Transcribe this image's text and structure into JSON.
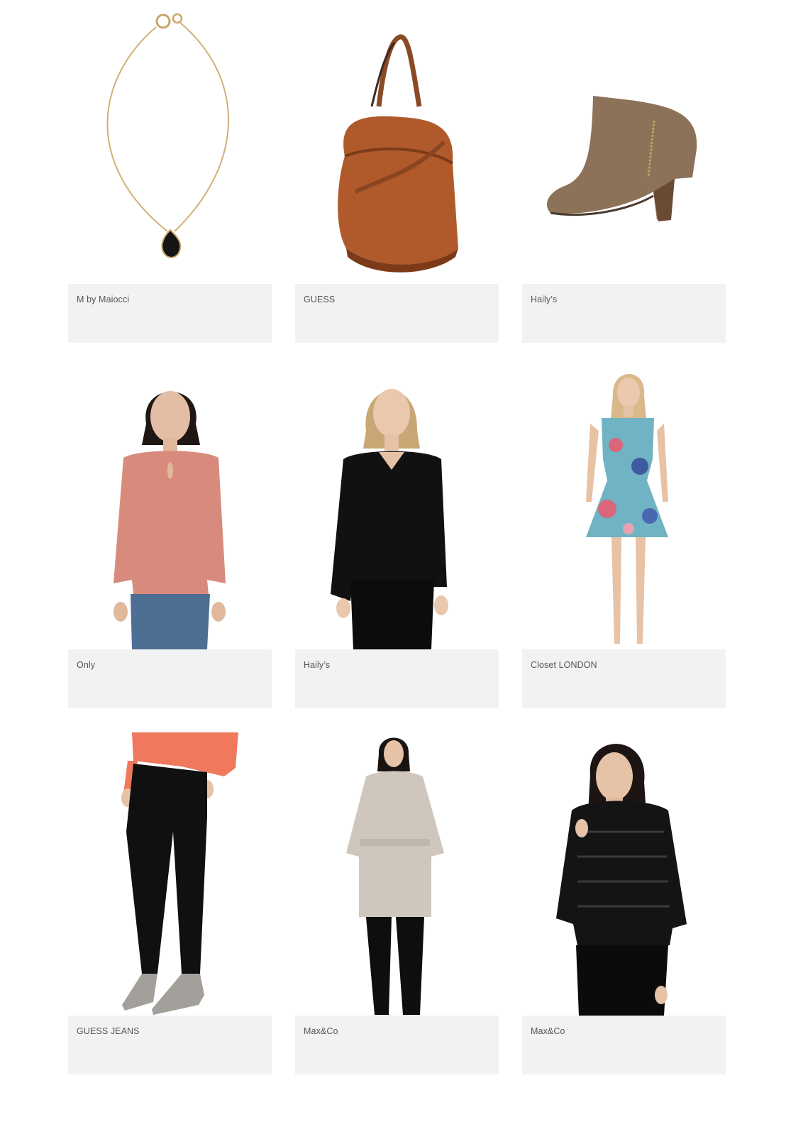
{
  "products": [
    {
      "brand": "M by Maiocci",
      "image": "necklace-image"
    },
    {
      "brand": "GUESS",
      "image": "bucket-bag-image"
    },
    {
      "brand": "Haily’s",
      "image": "ankle-boot-image"
    },
    {
      "brand": "Only",
      "image": "pink-blouse-image"
    },
    {
      "brand": "Haily’s",
      "image": "black-blouse-image"
    },
    {
      "brand": "Closet LONDON",
      "image": "floral-dress-image"
    },
    {
      "brand": "GUESS JEANS",
      "image": "black-trousers-image"
    },
    {
      "brand": "Max&Co",
      "image": "grey-coat-image"
    },
    {
      "brand": "Max&Co",
      "image": "puffer-jacket-image"
    }
  ],
  "colors": {
    "info_background": "#f2f2f2",
    "brand_text": "#555555"
  }
}
